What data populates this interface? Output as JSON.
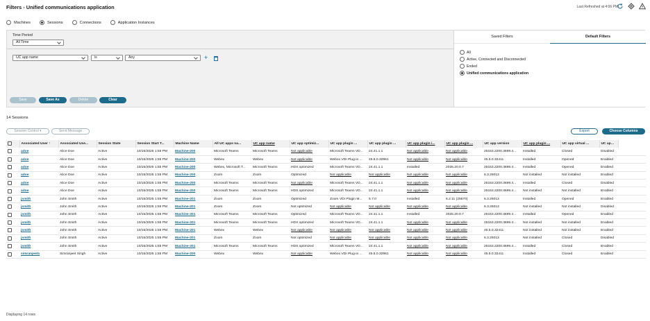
{
  "header": {
    "title": "Filters - Unified communications application",
    "last_refreshed": "Last Refreshed at 4:06 PM"
  },
  "view_options": [
    {
      "label": "Machines",
      "selected": false
    },
    {
      "label": "Sessions",
      "selected": true
    },
    {
      "label": "Connections",
      "selected": false
    },
    {
      "label": "Application Instances",
      "selected": false
    }
  ],
  "filter": {
    "time_period_label": "Time Period",
    "time_period_value": "All Time",
    "field_value": "UC app name",
    "operator_value": "is",
    "value_value": "Any",
    "buttons": {
      "save": "Save",
      "save_as": "Save As",
      "delete": "Delete",
      "clear": "Clear"
    }
  },
  "filter_tabs": {
    "saved": "Saved Filters",
    "default": "Default Filters"
  },
  "default_filters": [
    {
      "label": "All",
      "selected": false
    },
    {
      "label": "Active, Connected and Disconnected",
      "selected": false
    },
    {
      "label": "Ended",
      "selected": false
    },
    {
      "label": "Unified communications application",
      "selected": true
    }
  ],
  "session_count": "14 Sessions",
  "toolbar": {
    "session_control": "Session Control",
    "send_message": "Send Message",
    "export": "Export",
    "choose_columns": "Choose Columns"
  },
  "table": {
    "columns": [
      "Associated User",
      "Associated Use...",
      "Session State",
      "Session Start T...",
      "Machine Name",
      "All UC apps na...",
      "UC app name",
      "UC app optimiz...",
      "UC app plugin ...",
      "UC app plugin ...",
      "UC app plugin i...",
      "UC app plugin ...",
      "UC app version",
      "UC app plugin ...",
      "UC app virtual ...",
      "UC app virtual ..."
    ],
    "rows": [
      [
        "adoe",
        "Alice Doe",
        "Active",
        "10/15/2025 1:55 PM",
        "Machine-200",
        "Microsoft Teams",
        "Microsoft Teams",
        "Not applicable",
        "Microsoft Teams VD...",
        "24.41.1.1",
        "Not applicable",
        "Not applicable",
        "25153.2200.3699.4...",
        "Installed",
        "Closed",
        "Disabled"
      ],
      [
        "adoe",
        "Alice Doe",
        "Active",
        "10/15/2025 1:55 PM",
        "Machine-200",
        "Webex",
        "Webex",
        "Not applicable",
        "Webex VDI Plug-in ...",
        "45.8.0.32961",
        "Not applicable",
        "Not applicable",
        "45.5.0.32411",
        "Installed",
        "Opened",
        "Enabled"
      ],
      [
        "adoe",
        "Alice Doe",
        "Active",
        "10/15/2025 1:55 PM",
        "Machine-200",
        "Webex, Microsoft T...",
        "Microsoft Teams",
        "HDX optimized",
        "Microsoft Teams VD...",
        "24.41.1.1",
        "Installed",
        "2025.20.0.7",
        "25153.2200.3699.4...",
        "Installed",
        "Opened",
        "Enabled"
      ],
      [
        "adoe",
        "Alice Doe",
        "Active",
        "10/15/2025 1:55 PM",
        "Machine-200",
        "Zoom",
        "Zoom",
        "Optimized",
        "Not applicable",
        "Not applicable",
        "Not applicable",
        "Not applicable",
        "6.3.26013",
        "Not installed",
        "Not installed",
        "Enabled"
      ],
      [
        "adoe",
        "Alice Doe",
        "Active",
        "10/15/2025 1:55 PM",
        "Machine-200",
        "Microsoft Teams",
        "Microsoft Teams",
        "Not applicable",
        "Microsoft Teams VD...",
        "24.41.1.1",
        "Not applicable",
        "Not applicable",
        "25153.2200.3699.4...",
        "Installed",
        "Closed",
        "Disabled"
      ],
      [
        "adoe",
        "Alice Doe",
        "Active",
        "10/15/2025 1:55 PM",
        "Machine-200",
        "Microsoft Teams",
        "Microsoft Teams",
        "HDX optimized",
        "Microsoft Teams VD...",
        "24.41.1.1",
        "Not applicable",
        "Not applicable",
        "25153.2200.3699.4...",
        "Not installed",
        "Not installed",
        "Enabled"
      ],
      [
        "jsmith",
        "John Smith",
        "Active",
        "10/15/2025 1:55 PM",
        "Machine-201",
        "Zoom",
        "Zoom",
        "Optimized",
        "Zoom VDI Plugin M...",
        "5.7.0",
        "Installed",
        "6.2.11 (25670)",
        "6.3.26013",
        "Installed",
        "Opened",
        "Enabled"
      ],
      [
        "jsmith",
        "John Smith",
        "Active",
        "10/15/2025 1:55 PM",
        "Machine-201",
        "Zoom",
        "Zoom",
        "Not optimized",
        "Not applicable",
        "Not applicable",
        "Not applicable",
        "Not applicable",
        "6.3.26013",
        "Not installed",
        "Not installed",
        "Disabled"
      ],
      [
        "jsmith",
        "John Smith",
        "Active",
        "10/15/2025 1:55 PM",
        "Machine-201",
        "Microsoft Teams",
        "Microsoft Teams",
        "Optimized",
        "Microsoft Teams VD...",
        "24.41.1.1",
        "Installed",
        "2025.20.0.7",
        "25153.2200.3699.4...",
        "Installed",
        "Opened",
        "Enabled"
      ],
      [
        "jsmith",
        "John Smith",
        "Active",
        "10/15/2025 1:55 PM",
        "Machine-201",
        "Microsoft Teams",
        "Microsoft Teams",
        "HDX optimized",
        "Microsoft Teams VD...",
        "24.41.1.1",
        "Not applicable",
        "Not applicable",
        "25153.2200.3699.4...",
        "Not installed",
        "Not installed",
        "Enabled"
      ],
      [
        "jsmith",
        "John Smith",
        "Active",
        "10/15/2025 1:55 PM",
        "Machine-201",
        "Webex",
        "Webex",
        "Not applicable",
        "Not applicable",
        "Not applicable",
        "Not applicable",
        "Not applicable",
        "45.5.0.32411",
        "Not installed",
        "Not installed",
        "Enabled"
      ],
      [
        "jsmith",
        "John Smith",
        "Active",
        "10/15/2025 1:55 PM",
        "Machine-201",
        "Zoom",
        "Zoom",
        "Not optimized",
        "Not applicable",
        "Not applicable",
        "Not applicable",
        "Not applicable",
        "6.3.26013",
        "Not installed",
        "Closed",
        "Disabled"
      ],
      [
        "jsmith",
        "John Smith",
        "Active",
        "10/15/2025 1:55 PM",
        "Machine-201",
        "Microsoft Teams",
        "Microsoft Teams",
        "HDX optimized",
        "Microsoft Teams VD...",
        "24.41.1.1",
        "Not applicable",
        "Not applicable",
        "25153.2200.3699.4...",
        "Installed",
        "Closed",
        "Enabled"
      ],
      [
        "simranjeets",
        "Simranjeet Singh",
        "Active",
        "10/15/2025 1:55 PM",
        "Machine-200",
        "Webex",
        "Webex",
        "Not applicable",
        "Webex VDI Plug-in ...",
        "45.8.0.32961",
        "Not applicable",
        "Not applicable",
        "45.5.0.32411",
        "Installed",
        "Closed",
        "Enabled"
      ]
    ]
  },
  "footer": "Displaying 14 rows"
}
